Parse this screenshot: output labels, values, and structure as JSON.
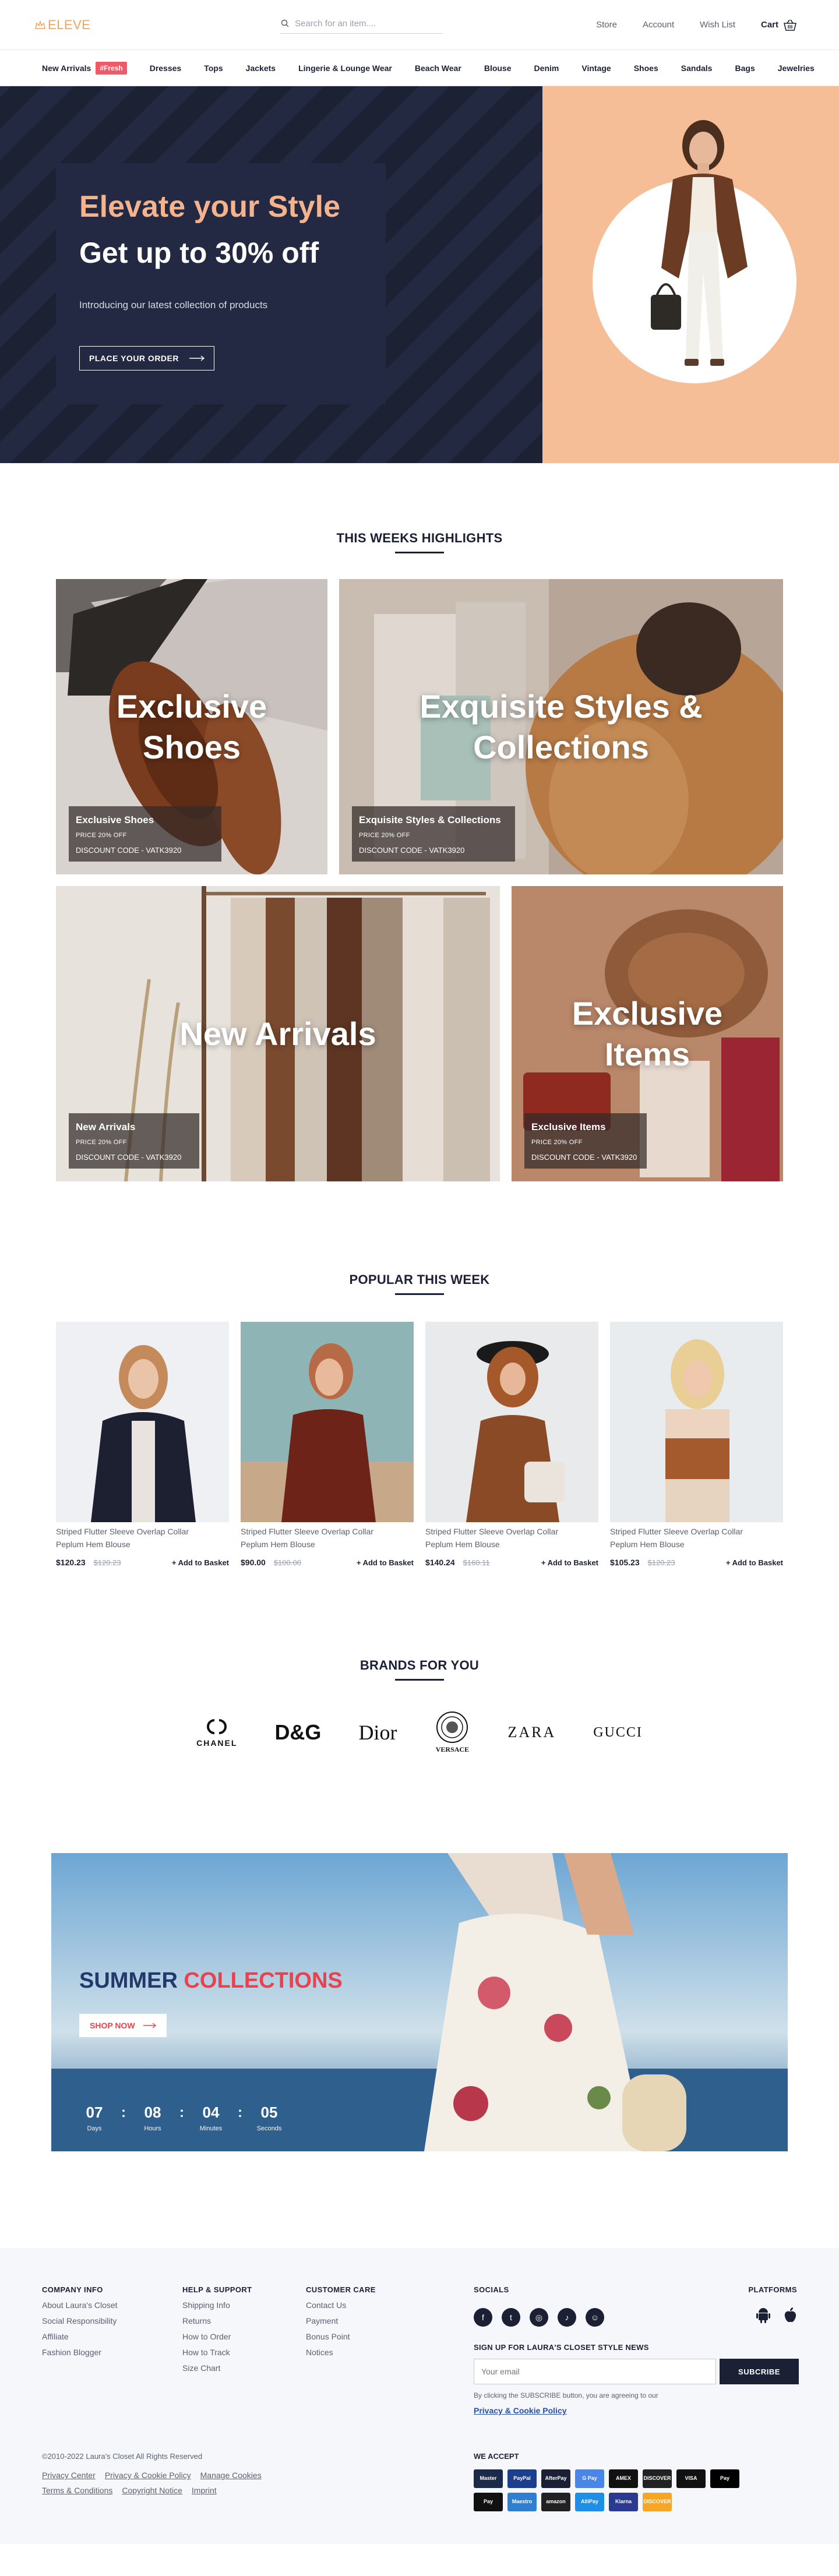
{
  "header": {
    "logo": "ELEVE",
    "search_placeholder": "Search for an item....",
    "links": [
      "Store",
      "Account",
      "Wish List"
    ],
    "cart_label": "Cart"
  },
  "nav": {
    "items": [
      "New Arrivals",
      "Dresses",
      "Tops",
      "Jackets",
      "Lingerie & Lounge Wear",
      "Beach Wear",
      "Blouse",
      "Denim",
      "Vintage",
      "Shoes",
      "Sandals",
      "Bags",
      "Jewelries"
    ],
    "fresh_badge": "#Fresh"
  },
  "hero": {
    "title": "Elevate your Style",
    "subtitle": "Get up to 30% off",
    "text": "Introducing our latest collection of products",
    "button": "PLACE YOUR ORDER"
  },
  "highlights": {
    "title": "THIS WEEKS HIGHLIGHTS",
    "tiles": [
      {
        "big1": "Exclusive",
        "big2": "Shoes",
        "name": "Exclusive Shoes",
        "price": "PRICE 20% OFF",
        "code": "DISCOUNT CODE - VATK3920"
      },
      {
        "big1": "Exquisite Styles &",
        "big2": "Collections",
        "name": "Exquisite Styles & Collections",
        "price": "PRICE 20% OFF",
        "code": "DISCOUNT CODE - VATK3920"
      },
      {
        "big1": "New Arrivals",
        "big2": "",
        "name": "New Arrivals",
        "price": "PRICE 20% OFF",
        "code": "DISCOUNT CODE - VATK3920"
      },
      {
        "big1": "Exclusive",
        "big2": "Items",
        "name": "Exclusive Items",
        "price": "PRICE 20% OFF",
        "code": "DISCOUNT CODE - VATK3920"
      }
    ]
  },
  "popular": {
    "title": "POPULAR THIS WEEK",
    "add_label": "+ Add to Basket",
    "products": [
      {
        "name1": "Striped Flutter Sleeve Overlap Collar",
        "name2": "Peplum Hem Blouse",
        "price": "$120.23",
        "old": "$120.23"
      },
      {
        "name1": "Striped Flutter Sleeve Overlap Collar",
        "name2": "Peplum Hem Blouse",
        "price": "$90.00",
        "old": "$100.00"
      },
      {
        "name1": "Striped Flutter Sleeve Overlap Collar",
        "name2": "Peplum Hem Blouse",
        "price": "$140.24",
        "old": "$160.11"
      },
      {
        "name1": "Striped Flutter Sleeve Overlap Collar",
        "name2": "Peplum Hem Blouse",
        "price": "$105.23",
        "old": "$120.23"
      }
    ]
  },
  "brands": {
    "title": "BRANDS FOR YOU",
    "items": [
      "CHANEL",
      "D&G",
      "Dior",
      "VERSACE",
      "ZARA",
      "GUCCI"
    ]
  },
  "summer": {
    "title_a": "SUMMER",
    "title_b": "COLLECTIONS",
    "button": "SHOP NOW",
    "countdown": [
      {
        "value": "07",
        "label": "Days"
      },
      {
        "value": "08",
        "label": "Hours"
      },
      {
        "value": "04",
        "label": "Minutes"
      },
      {
        "value": "05",
        "label": "Seconds"
      }
    ]
  },
  "footer": {
    "company": {
      "title": "COMPANY INFO",
      "links": [
        "About Laura's Closet",
        "Social Responsibility",
        "Affiliate",
        "Fashion Blogger"
      ]
    },
    "help": {
      "title": "HELP & SUPPORT",
      "links": [
        "Shipping Info",
        "Returns",
        "How to Order",
        "How to Track",
        "Size Chart"
      ]
    },
    "care": {
      "title": "CUSTOMER CARE",
      "links": [
        "Contact Us",
        "Payment",
        "Bonus Point",
        "Notices"
      ]
    },
    "socials_title": "SOCIALS",
    "platforms_title": "PLATFORMS",
    "newsletter_title": "SIGN UP FOR LAURA'S CLOSET  STYLE NEWS",
    "email_placeholder": "Your email",
    "subscribe": "SUBCRIBE",
    "note_prefix": "By clicking the SUBSCRIBE button, you are agreeing to our",
    "note_link": "Privacy & Cookie Policy",
    "copyright": "©2010-2022 Laura's Closet All Rights Reserved",
    "legal": [
      "Privacy Center",
      "Privacy & Cookie Policy",
      "Manage Cookies",
      "Terms & Conditions",
      "Copyright Notice",
      "Imprint"
    ],
    "we_accept": "WE ACCEPT",
    "payments": [
      {
        "label": "Master",
        "color": "#1b2a4a"
      },
      {
        "label": "PayPal",
        "color": "#1b3f8f"
      },
      {
        "label": "AfterPay",
        "color": "#1b2034"
      },
      {
        "label": "G Pay",
        "color": "#4a86e8"
      },
      {
        "label": "AMEX",
        "color": "#111111"
      },
      {
        "label": "DISCOVER",
        "color": "#222222"
      },
      {
        "label": "VISA",
        "color": "#111111"
      },
      {
        "label": "Pay",
        "color": "#000000"
      },
      {
        "label": "Pay",
        "color": "#111111"
      },
      {
        "label": "Maestro",
        "color": "#2f7fd1"
      },
      {
        "label": "amazon",
        "color": "#222222"
      },
      {
        "label": "AlliPay",
        "color": "#1e8fe6"
      },
      {
        "label": "Klarna",
        "color": "#2a3a8f"
      },
      {
        "label": "DISCOVER",
        "color": "#f5a623"
      }
    ]
  },
  "colors": {
    "accent": "#f2a35c",
    "navy": "#1b2034",
    "peach": "#f6be96",
    "red": "#e7434d"
  }
}
